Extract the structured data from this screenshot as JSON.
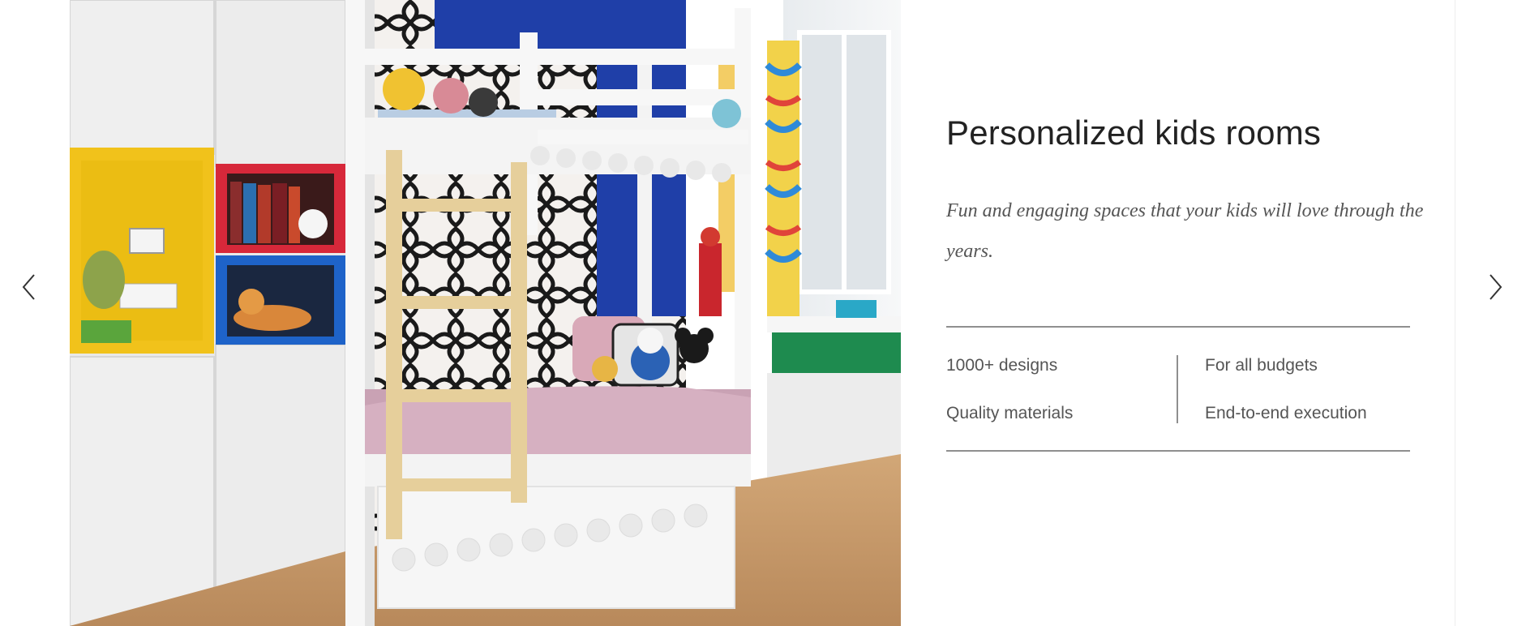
{
  "slide": {
    "title": "Personalized kids rooms",
    "subtitle": "Fun and engaging spaces that your kids will love through the years.",
    "features": [
      "1000+ designs",
      "For all budgets",
      "Quality materials",
      "End-to-end execution"
    ]
  },
  "carousel": {
    "prev_icon": "chevron-left-icon",
    "next_icon": "chevron-right-icon"
  },
  "image": {
    "subject": "kids-bunk-bed-room-photo"
  },
  "colors": {
    "title_text": "#222222",
    "body_text": "#555555",
    "rule": "#8f8f8f",
    "wall_blue": "#1f3fa8",
    "cubby_yellow": "#f1c21b",
    "cubby_red": "#d7283a",
    "cubby_blue": "#1e63c9",
    "desk_green": "#1e8b4f",
    "bed_pink": "#c9a2b4",
    "floor_wood": "#c89a6a"
  }
}
